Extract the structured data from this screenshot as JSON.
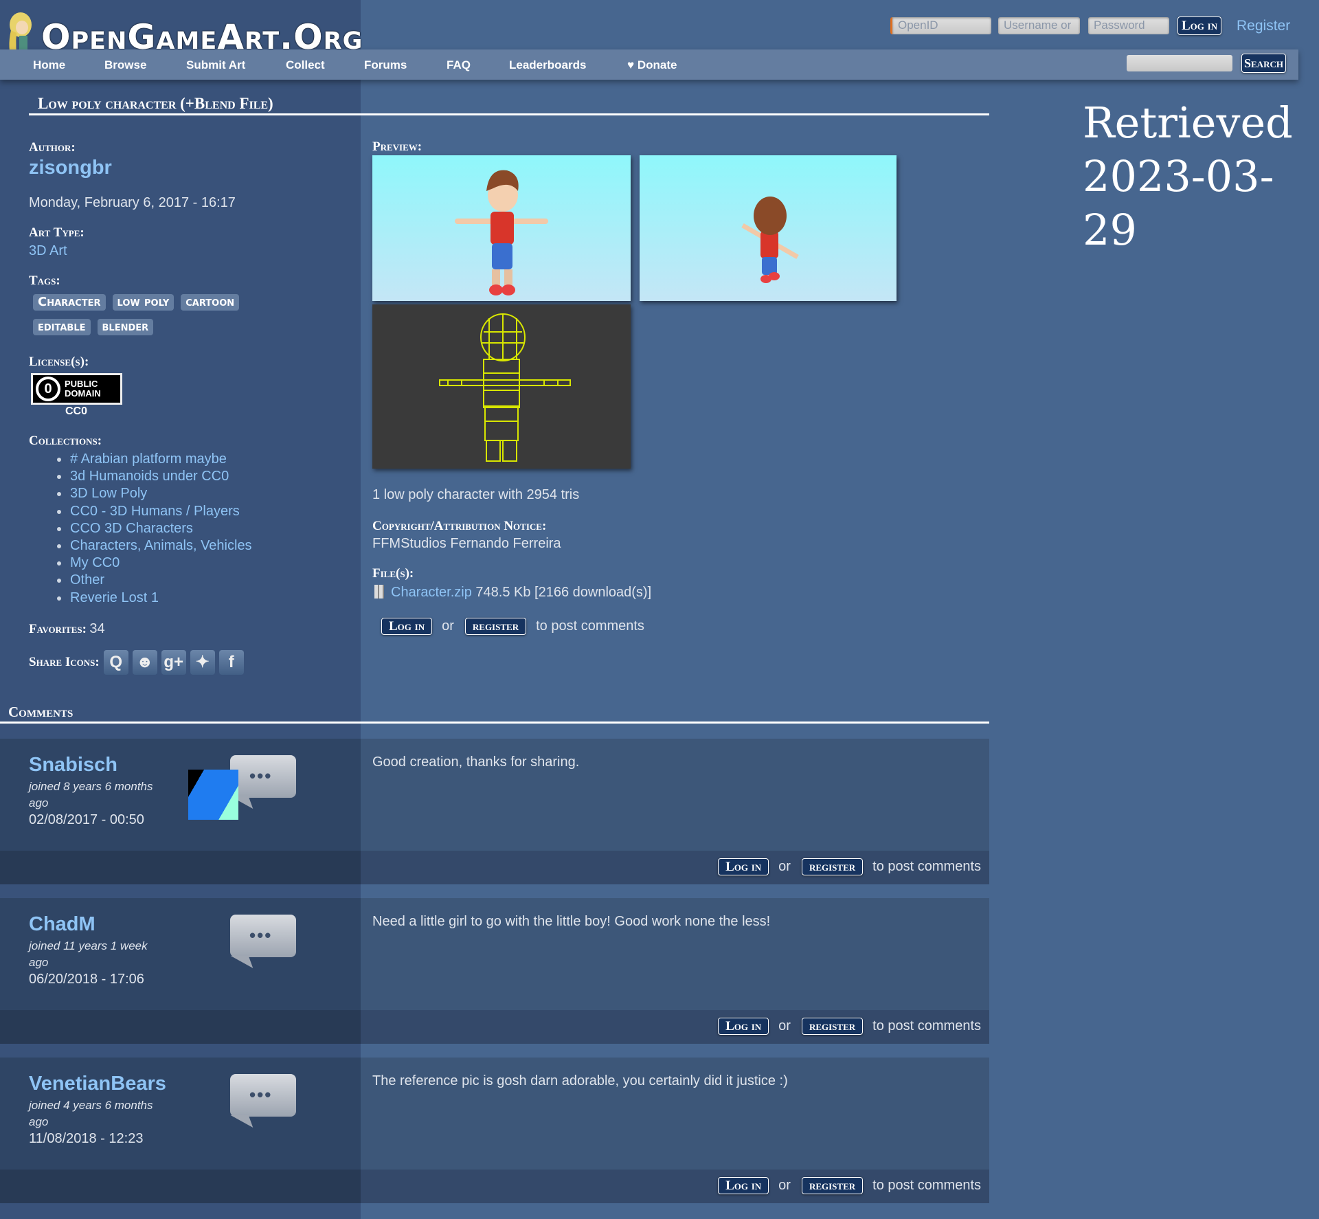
{
  "site": {
    "logo_text": "OpenGameArt.Org"
  },
  "header": {
    "openid_placeholder": "OpenID",
    "username_placeholder": "Username or",
    "password_placeholder": "Password",
    "login_label": "Log in",
    "register_label": "Register",
    "search_label": "Search"
  },
  "nav": {
    "items": [
      "Home",
      "Browse",
      "Submit Art",
      "Collect",
      "Forums",
      "FAQ",
      "Leaderboards",
      "Donate"
    ]
  },
  "retrieved": {
    "line1": "Retrieved",
    "line2": "2023-03-29"
  },
  "page": {
    "title": "Low poly character (+Blend File)"
  },
  "sidebar": {
    "author_label": "Author:",
    "author": "zisongbr",
    "date": "Monday, February 6, 2017 - 16:17",
    "art_type_label": "Art Type:",
    "art_type": "3D Art",
    "tags_label": "Tags:",
    "tags": [
      "Character",
      "low poly",
      "cartoon",
      "editable",
      "blender"
    ],
    "license_label": "License(s):",
    "license_badge": "PUBLIC DOMAIN",
    "license": "CC0",
    "collections_label": "Collections:",
    "collections": [
      "# Arabian platform maybe",
      "3d Humanoids under CC0",
      "3D Low Poly",
      "CC0 - 3D Humans / Players",
      "CCO 3D Characters",
      "Characters, Animals, Vehicles",
      "My CC0",
      "Other",
      "Reverie Lost 1"
    ],
    "favorites_label": "Favorites:",
    "favorites": "34",
    "share_label": "Share Icons:",
    "share_icons": [
      "quitter-icon",
      "reddit-icon",
      "google-plus-icon",
      "twitter-icon",
      "facebook-icon"
    ]
  },
  "main": {
    "preview_label": "Preview:",
    "description": "1 low poly character with 2954 tris",
    "copyright_label": "Copyright/Attribution Notice:",
    "copyright": "FFMStudios Fernando Ferreira",
    "files_label": "File(s):",
    "file_name": "Character.zip",
    "file_info": "748.5 Kb [2166 download(s)]",
    "login": "Log in",
    "or": "or",
    "register": "register",
    "post_suffix": "to post comments"
  },
  "comments": {
    "heading": "Comments",
    "items": [
      {
        "user": "Snabisch",
        "joined": "joined 8 years 6 months ago",
        "date": "02/08/2017 - 00:50",
        "text": "Good creation, thanks for sharing."
      },
      {
        "user": "ChadM",
        "joined": "joined 11 years 1 week ago",
        "date": "06/20/2018 - 17:06",
        "text": "Need a little girl to go with the little boy! Good work none the less!"
      },
      {
        "user": "VenetianBears",
        "joined": "joined 4 years 6 months ago",
        "date": "11/08/2018 - 12:23",
        "text": "The reference pic is gosh darn adorable, you certainly did it justice :)"
      }
    ]
  },
  "colors": {
    "sidebar": "#39527a",
    "main": "#47668f",
    "link": "#8fc4f5",
    "button": "#16335f",
    "preview_bg": "#8ff7fb",
    "wireframe": "#d8e600"
  }
}
